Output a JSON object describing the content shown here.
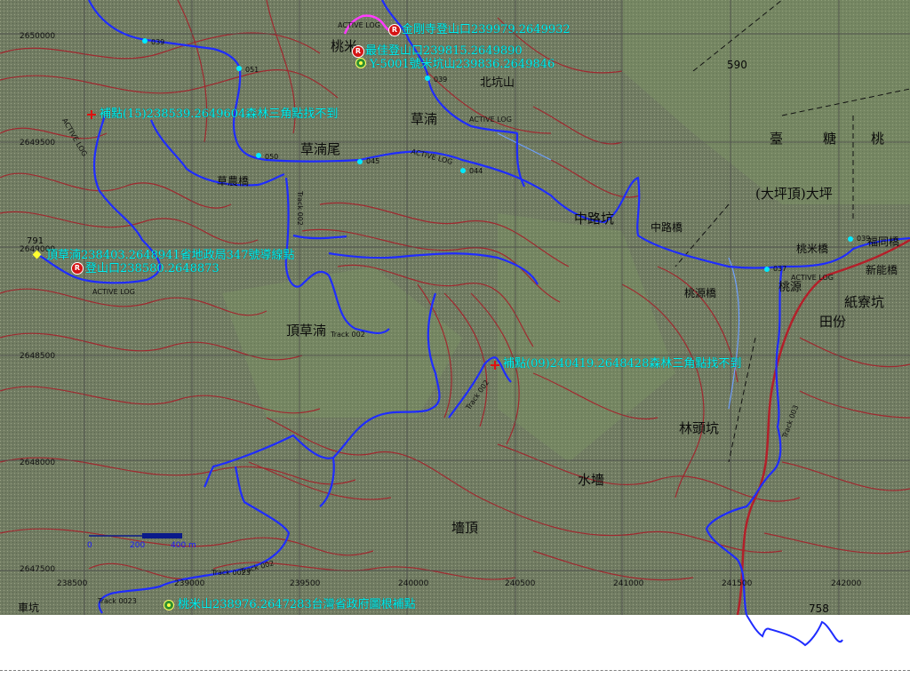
{
  "map": {
    "grid_labels": {
      "easting": [
        "238500",
        "239000",
        "239500",
        "240000",
        "240500",
        "241000",
        "241500",
        "242000"
      ],
      "northing": [
        "2650000",
        "2649500",
        "2649000",
        "2648500",
        "2648000",
        "2647500"
      ]
    },
    "markers": [
      {
        "icon": "R",
        "label": "金剛寺登山口239979.2649932"
      },
      {
        "icon": "R",
        "label": "最佳登山口239815.2649890"
      },
      {
        "icon": "peak",
        "label": "Y-5001號米坑山239836.2649846"
      },
      {
        "icon": "cross",
        "label": "補點(15)238539.2649604森林三角點找不到"
      },
      {
        "icon": "diamond",
        "label": "頂草湳238403.2648941省地政局347號導線點"
      },
      {
        "icon": "R",
        "label": "登山口238580.2648873"
      },
      {
        "icon": "cross",
        "label": "補點(09)240419.2648428森林三角點找不到"
      },
      {
        "icon": "peak",
        "label": "桃米山238976.2647283台灣省政府圖根補點"
      }
    ],
    "place_names": [
      "桃米",
      "草湳尾",
      "草湳",
      "頂草湳",
      "中路坑",
      "中路橋",
      "林頭坑",
      "水墻",
      "墻頂",
      "臺",
      "糖",
      "桃",
      "(大坪頂)大坪",
      "桃米橋",
      "福同橋",
      "新能橋",
      "桃源",
      "桃源橋",
      "紙寮坑",
      "田份",
      "草農橋",
      "北坑山",
      "車坑"
    ],
    "waypoints": [
      "039",
      "051",
      "039",
      "050",
      "045",
      "044",
      "037",
      "039"
    ],
    "track_labels": [
      "ACTIVE LOG",
      "ACTIVE LOG",
      "ACTIVE LOG",
      "ACTIVE LOG",
      "ACTIVE LOG",
      "ACTIVE LOG",
      "Track 002",
      "Track 002",
      "Track 002",
      "Track 003",
      "Track 002",
      "Track 0023",
      "Track 0023"
    ],
    "elevations": [
      "590",
      "758",
      "791"
    ],
    "scale_bar": {
      "labels": [
        "0",
        "200",
        "400 m"
      ]
    },
    "colors": {
      "background": "#6f7a5f",
      "contour": "#a5202a",
      "track": "#1f2cff",
      "route": "#ff3cff",
      "label": "#00f0f0"
    }
  }
}
